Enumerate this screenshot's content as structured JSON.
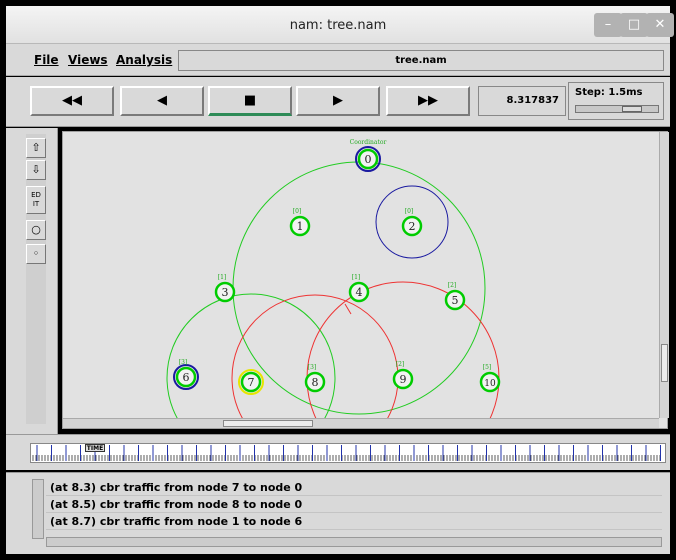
{
  "window": {
    "title": "nam: tree.nam",
    "controls": [
      "minimize-icon",
      "maximize-icon",
      "close-icon"
    ]
  },
  "menu": {
    "file": "File",
    "views": "Views",
    "analysis": "Analysis",
    "filename": "tree.nam"
  },
  "toolbar": {
    "rewind": "◀◀",
    "back": "◀",
    "stop": "■",
    "play": "▶",
    "fastforward": "▶▶",
    "time": "8.317837",
    "step": "Step: 1.5ms"
  },
  "palette": {
    "edit": "ED IT"
  },
  "network": {
    "coordinator_label": "Coordinator",
    "nodes": [
      {
        "id": "0",
        "group": ""
      },
      {
        "id": "1",
        "group": "[0]"
      },
      {
        "id": "2",
        "group": "[0]"
      },
      {
        "id": "3",
        "group": "[1]"
      },
      {
        "id": "4",
        "group": "[1]"
      },
      {
        "id": "5",
        "group": "[2]"
      },
      {
        "id": "6",
        "group": "[3]"
      },
      {
        "id": "7",
        "group": ""
      },
      {
        "id": "8",
        "group": "[3]"
      },
      {
        "id": "9",
        "group": "[2]"
      },
      {
        "id": "10",
        "group": "[5]"
      }
    ],
    "colors": {
      "node_ring": "#00cc00",
      "highlight_blue": "#1a1aa0",
      "highlight_yellow": "#e6e600",
      "range_green": "#22cc22",
      "range_red": "#ee3333",
      "range_blue": "#1a1aa0"
    }
  },
  "timeline": {
    "marker": "TIME"
  },
  "log": {
    "lines": [
      "(at 8.3) cbr traffic from node 7 to node 0",
      "(at 8.5) cbr traffic from node 8 to node 0",
      "(at 8.7) cbr traffic from node 1 to node 6"
    ]
  }
}
